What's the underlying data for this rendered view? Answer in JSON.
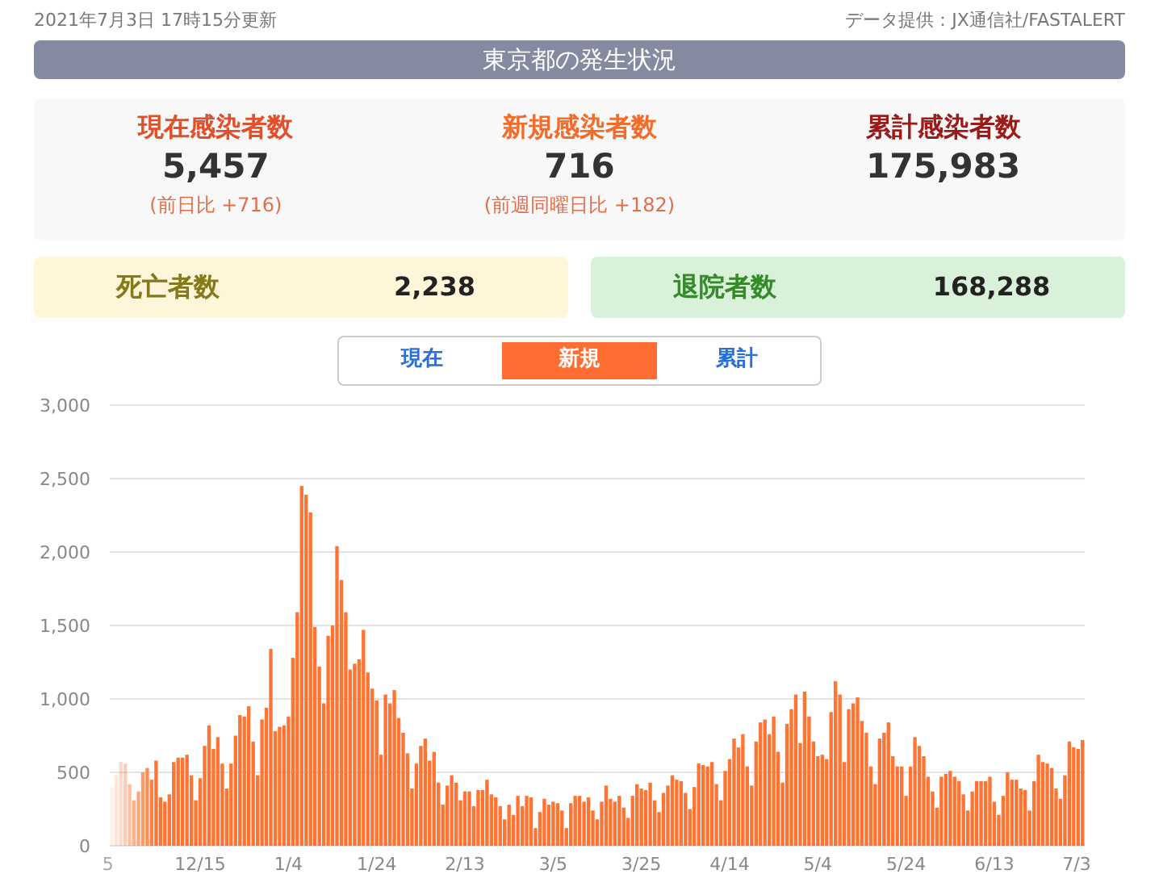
{
  "header": {
    "updated": "2021年7月3日 17時15分更新",
    "source": "データ提供：JX通信社/FASTALERT"
  },
  "title": "東京都の発生状況",
  "stats": [
    {
      "kind": "current",
      "label": "現在感染者数",
      "value": "5,457",
      "note": "(前日比 +716)"
    },
    {
      "kind": "new",
      "label": "新規感染者数",
      "value": "716",
      "note": "(前週同曜日比 +182)"
    },
    {
      "kind": "total",
      "label": "累計感染者数",
      "value": "175,983"
    }
  ],
  "outcomes": [
    {
      "kind": "deaths",
      "label": "死亡者数",
      "value": "2,238"
    },
    {
      "kind": "discharged",
      "label": "退院者数",
      "value": "168,288"
    }
  ],
  "tabs": [
    {
      "label": "現在",
      "selected": false
    },
    {
      "label": "新規",
      "selected": true
    },
    {
      "label": "累計",
      "selected": false
    }
  ],
  "chart_axis_labels": [
    "5",
    "12/15",
    "1/4",
    "1/24",
    "2/13",
    "3/5",
    "3/25",
    "4/14",
    "5/4",
    "5/24",
    "6/13",
    "7/3"
  ],
  "chart_data": {
    "type": "bar",
    "grid": true,
    "ylim": [
      0,
      3000
    ],
    "yticks": [
      {
        "value": 0,
        "label": "0"
      },
      {
        "value": 500,
        "label": "500"
      },
      {
        "value": 1000,
        "label": "1,000"
      },
      {
        "value": 1500,
        "label": "1,500"
      },
      {
        "value": 2000,
        "label": "2,000"
      },
      {
        "value": 2500,
        "label": "2,500"
      },
      {
        "value": 3000,
        "label": "3,000"
      }
    ],
    "values": [
      400,
      480,
      570,
      560,
      420,
      310,
      370,
      500,
      530,
      450,
      580,
      330,
      300,
      350,
      570,
      600,
      600,
      620,
      480,
      310,
      460,
      680,
      820,
      660,
      740,
      560,
      390,
      560,
      750,
      890,
      880,
      950,
      710,
      480,
      860,
      940,
      1340,
      780,
      810,
      820,
      880,
      1280,
      1590,
      2450,
      2390,
      2270,
      1490,
      1220,
      970,
      1430,
      1500,
      2040,
      1810,
      1590,
      1200,
      1240,
      1270,
      1470,
      1180,
      1070,
      990,
      620,
      1030,
      970,
      1060,
      870,
      770,
      630,
      390,
      560,
      680,
      730,
      580,
      640,
      430,
      280,
      410,
      480,
      430,
      310,
      370,
      370,
      270,
      380,
      380,
      450,
      350,
      330,
      270,
      180,
      280,
      210,
      340,
      270,
      340,
      330,
      120,
      230,
      320,
      280,
      300,
      290,
      240,
      120,
      290,
      340,
      340,
      300,
      330,
      240,
      180,
      300,
      410,
      320,
      300,
      340,
      260,
      190,
      340,
      420,
      390,
      380,
      430,
      310,
      230,
      360,
      410,
      480,
      450,
      440,
      360,
      250,
      400,
      560,
      550,
      540,
      570,
      420,
      310,
      510,
      590,
      730,
      670,
      760,
      540,
      410,
      710,
      840,
      860,
      760,
      880,
      640,
      430,
      830,
      930,
      1030,
      700,
      1050,
      880,
      710,
      610,
      620,
      590,
      910,
      1120,
      1030,
      570,
      930,
      970,
      1010,
      850,
      770,
      540,
      420,
      730,
      770,
      840,
      610,
      540,
      540,
      340,
      540,
      740,
      680,
      610,
      470,
      370,
      260,
      470,
      490,
      510,
      470,
      440,
      350,
      240,
      370,
      440,
      440,
      440,
      470,
      300,
      210,
      340,
      500,
      450,
      450,
      390,
      380,
      240,
      440,
      620,
      570,
      560,
      530,
      390,
      320,
      480,
      710,
      670,
      660,
      720
    ]
  }
}
